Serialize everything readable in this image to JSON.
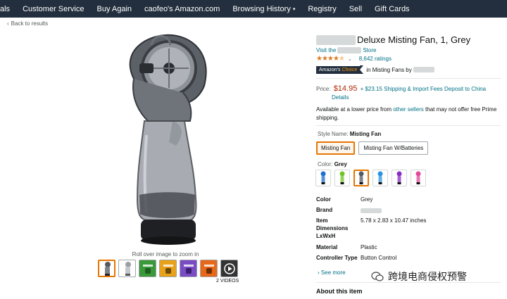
{
  "nav": {
    "items": [
      "als",
      "Customer Service",
      "Buy Again",
      "caofeo's Amazon.com",
      "Browsing History",
      "Registry",
      "Sell",
      "Gift Cards"
    ]
  },
  "back_link": "Back to results",
  "zoom_hint": "Roll over image to zoom in",
  "videos_label": "2 VIDEOS",
  "product": {
    "title": "Deluxe Misting Fan, 1, Grey",
    "store_prefix": "Visit the",
    "store_suffix": "Store",
    "rating_count": "8,642 ratings",
    "rating_value": 4.5,
    "choice_badge_prefix": "Amazon's ",
    "choice_badge_highlight": "Choice",
    "choice_text": "in Misting Fans by",
    "price_label": "Price:",
    "price": "$14.95",
    "shipping": "+ $23.15 Shipping & Import Fees Deposit to China",
    "details_link": "Details",
    "avail_text_1": "Available at a lower price from ",
    "avail_link": "other sellers",
    "avail_text_2": " that may not offer free Prime shipping.",
    "style_label": "Style Name: ",
    "style_selected": "Misting Fan",
    "style_options": [
      "Misting Fan",
      "Misting Fan W/Batteries"
    ],
    "color_label": "Color: ",
    "color_selected": "Grey",
    "swatch_colors": [
      "#1f6fd1",
      "#72c42a",
      "#555a60",
      "#2b92e0",
      "#8a2bc4",
      "#e0479b"
    ],
    "specs": [
      {
        "key": "Color",
        "value": "Grey"
      },
      {
        "key": "Brand",
        "value": ""
      },
      {
        "key": "Item Dimensions LxWxH",
        "value": "5.78 x 2.83 x 10.47 inches"
      },
      {
        "key": "Material",
        "value": "Plastic"
      },
      {
        "key": "Controller Type",
        "value": "Button Control"
      }
    ],
    "see_more": "See more",
    "about": "About this item"
  },
  "thumb_colors": [
    "#555a60",
    "#9aa0a6",
    "#3a9a3a",
    "#e8a21a",
    "#7a4cc4",
    "#e8681a",
    "#333333"
  ],
  "watermark_text": "跨境电商侵权预警"
}
